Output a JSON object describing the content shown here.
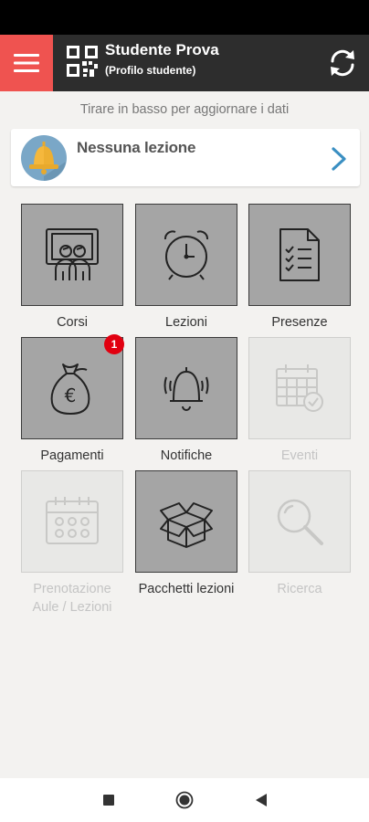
{
  "header": {
    "user_name": "Studente Prova",
    "user_role": "(Profilo studente)",
    "menu_icon": "hamburger-icon",
    "qr_icon": "qr-code-icon",
    "refresh_icon": "refresh-icon",
    "accent_color": "#ef5350",
    "bar_color": "#2d2d2d"
  },
  "hint": "Tirare in basso per aggiornare i dati",
  "lesson_card": {
    "label": "Nessuna lezione",
    "icon": "bell-avatar-icon",
    "chevron": "chevron-right-icon"
  },
  "tiles": [
    {
      "label": "Corsi",
      "icon": "class-board-icon",
      "enabled": true
    },
    {
      "label": "Lezioni",
      "icon": "alarm-clock-icon",
      "enabled": true
    },
    {
      "label": "Presenze",
      "icon": "checklist-icon",
      "enabled": true
    },
    {
      "label": "Pagamenti",
      "icon": "money-bag-icon",
      "enabled": true,
      "badge": "1"
    },
    {
      "label": "Notifiche",
      "icon": "ringing-bell-icon",
      "enabled": true
    },
    {
      "label": "Eventi",
      "icon": "calendar-check-icon",
      "enabled": false
    },
    {
      "label": "Prenotazione Aule / Lezioni",
      "icon": "calendar-booking-icon",
      "enabled": false
    },
    {
      "label": "Pacchetti lezioni",
      "icon": "open-box-icon",
      "enabled": true
    },
    {
      "label": "Ricerca",
      "icon": "search-icon",
      "enabled": false
    }
  ],
  "navbar": {
    "recent_icon": "square-recents-icon",
    "home_icon": "circle-home-icon",
    "back_icon": "triangle-back-icon"
  }
}
